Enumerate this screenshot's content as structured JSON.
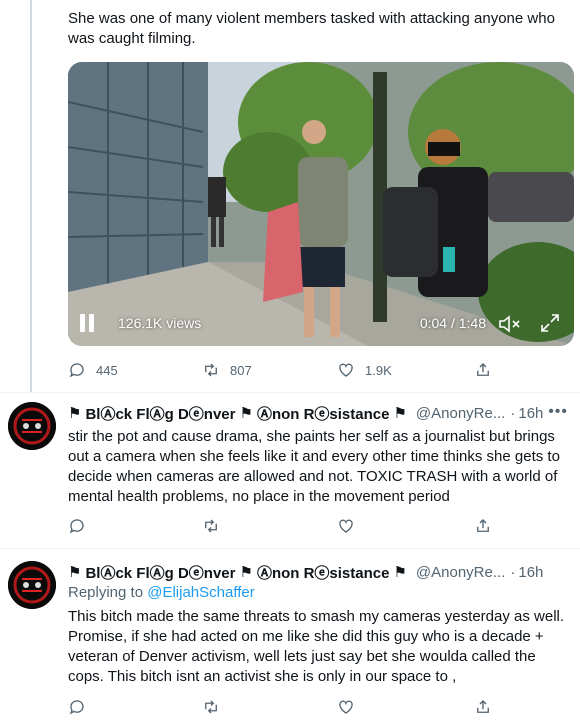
{
  "main_tweet": {
    "text": "She was one of many violent members tasked with attacking anyone who was caught filming.",
    "video": {
      "views": "126.1K views",
      "time": "0:04 / 1:48",
      "progress": 0.04
    },
    "actions": {
      "replies": "445",
      "retweets": "807",
      "likes": "1.9K"
    }
  },
  "replies": [
    {
      "name_part1": "BlⒶck FlⒶg Dⓔnver",
      "name_part2": "Ⓐnon Rⓔsistance",
      "handle": "@AnonyRe...",
      "time": "16h",
      "text": "stir the pot and cause drama, she paints her self as a journalist but brings out a camera when she feels like it and every other time thinks she gets to decide when cameras are allowed and not. TOXIC TRASH with a world of mental health problems, no place in the movement period"
    },
    {
      "name_part1": "BlⒶck FlⒶg Dⓔnver",
      "name_part2": "Ⓐnon Rⓔsistance",
      "handle": "@AnonyRe...",
      "time": "16h",
      "replying_label": "Replying to",
      "replying_to": "@ElijahSchaffer",
      "text": "This bitch made the same threats to smash my cameras yesterday as well. Promise, if she had acted on me like she did this guy who is a decade + veteran of Denver activism, well lets just say bet she woulda called the cops. This bitch isnt an activist she is only in our space to ,"
    }
  ],
  "icons": {
    "flag": "black-flag-icon",
    "more": "more-dots-icon",
    "reply": "reply-icon",
    "retweet": "retweet-icon",
    "like": "heart-icon",
    "share": "share-icon"
  },
  "separators": {
    "dot": "·",
    "more": "•••",
    "flag_glyph": "⚑"
  },
  "colors": {
    "accent": "#1d9bf0",
    "secondary": "#536471",
    "text": "#0f1419"
  }
}
